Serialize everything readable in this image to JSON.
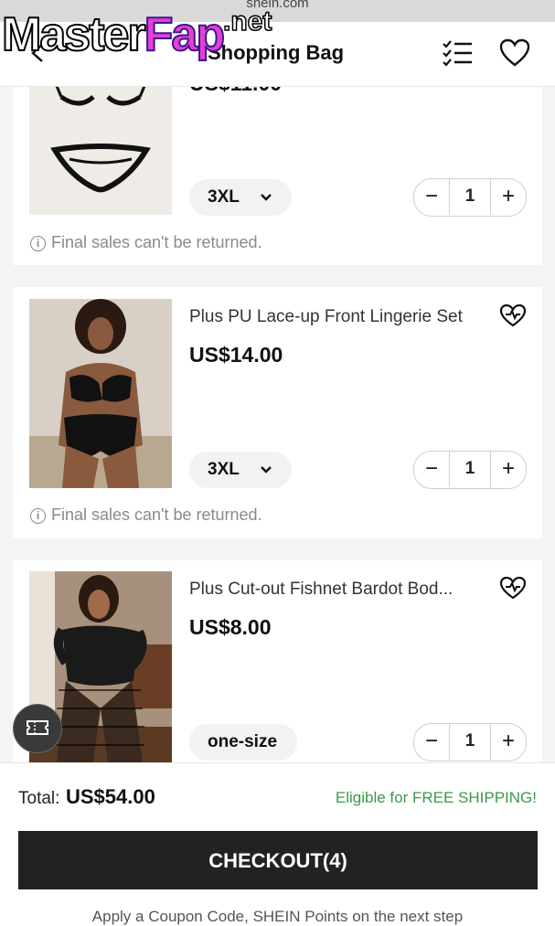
{
  "browser": {
    "url": "shein.com"
  },
  "watermark": {
    "master": "Master",
    "fap": "Fap",
    "net": ".net"
  },
  "header": {
    "title": "Shopping Bag",
    "back_icon": "chevron-left-icon",
    "list_icon": "checklist-icon",
    "wishlist_icon": "heart-icon"
  },
  "items": [
    {
      "price": "US$11.00",
      "size": "3XL",
      "quantity": "1",
      "notice": "Final sales can't be returned."
    },
    {
      "name": "Plus PU Lace-up Front Lingerie Set",
      "price": "US$14.00",
      "size": "3XL",
      "quantity": "1",
      "notice": "Final sales can't be returned."
    },
    {
      "name": "Plus Cut-out Fishnet Bardot Bod...",
      "price": "US$8.00",
      "size": "one-size",
      "quantity": "1"
    }
  ],
  "qty_controls": {
    "minus": "−",
    "plus": "+"
  },
  "notice_icon": "i",
  "footer": {
    "total_label": "Total:",
    "total_value": "US$54.00",
    "free_shipping": "Eligible for FREE SHIPPING!",
    "checkout_label": "CHECKOUT(4)",
    "bottom_text": "Apply a Coupon Code, SHEIN Points on the next step"
  },
  "colors": {
    "accent_green": "#3a9a4a",
    "checkout_bg": "#222222",
    "watermark_pink": "#e53fd3"
  }
}
